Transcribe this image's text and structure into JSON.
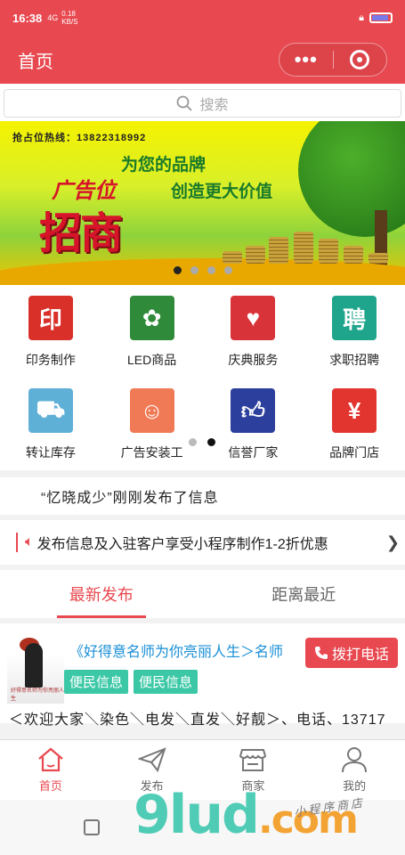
{
  "status": {
    "time": "16:38",
    "signal": "4G",
    "speed_value": "0.18",
    "speed_unit": "KB/S"
  },
  "header": {
    "title": "首页",
    "more_label": "•••"
  },
  "search": {
    "placeholder": "搜索"
  },
  "banner": {
    "hotline": "抢占位热线：13822318992",
    "slogan_line1": "为您的品牌",
    "slogan_line2": "创造更大价值",
    "title_small": "广告位",
    "title_big": "招商",
    "slide_count": 4,
    "active_slide": 1
  },
  "categories": [
    {
      "label": "印务制作",
      "icon": "print-icon",
      "glyph": "印",
      "color": "#d9302a"
    },
    {
      "label": "LED商品",
      "icon": "led-bulb-icon",
      "glyph": "✿",
      "color": "#2f8a3a"
    },
    {
      "label": "庆典服务",
      "icon": "celebration-arch-icon",
      "glyph": "♥",
      "color": "#d9333a"
    },
    {
      "label": "求职招聘",
      "icon": "recruit-icon",
      "glyph": "聘",
      "color": "#1fa58c"
    },
    {
      "label": "转让库存",
      "icon": "cart-icon",
      "glyph": "⛟",
      "color": "#5fb0d6"
    },
    {
      "label": "广告安装工",
      "icon": "worker-icon",
      "glyph": "☺",
      "color": "#f07a56"
    },
    {
      "label": "信誉厂家",
      "icon": "thumbs-up-icon",
      "glyph": "👍",
      "color": "#2c3f9c"
    },
    {
      "label": "品牌门店",
      "icon": "store-icon",
      "glyph": "¥",
      "color": "#e3352f"
    }
  ],
  "category_pages": {
    "count": 2,
    "active": 2
  },
  "notice": {
    "text": "“忆晓成少”刚刚发布了信息"
  },
  "promo": {
    "text": "发布信息及入驻客户享受小程序制作1-2折优惠"
  },
  "tabs": [
    {
      "label": "最新发布",
      "active": true
    },
    {
      "label": "距离最近",
      "active": false
    }
  ],
  "post": {
    "title": "《好得意名师为你亮丽人生＞名师",
    "tags": [
      "便民信息",
      "便民信息"
    ],
    "call_label": "拨打电话",
    "description": "＜欢迎大家＼染色＼电发＼直发＼好靓＞、电话、13717",
    "avatar_caption": "好得意名师为你亮丽人生"
  },
  "bottom_nav": [
    {
      "label": "首页",
      "icon": "home-icon",
      "active": true
    },
    {
      "label": "发布",
      "icon": "paper-plane-icon",
      "active": false
    },
    {
      "label": "商家",
      "icon": "shop-icon",
      "active": false
    },
    {
      "label": "我的",
      "icon": "user-icon",
      "active": false
    }
  ],
  "watermark": {
    "main": "9lud",
    "suffix": ".com",
    "sub": "小程序商店"
  },
  "colors": {
    "brand": "#e8484f",
    "tag": "#3cc8a6",
    "link": "#1a8fd6"
  }
}
